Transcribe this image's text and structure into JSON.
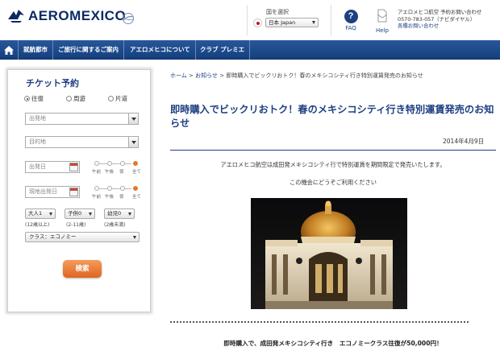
{
  "header": {
    "logo_text": "AEROMEXICO",
    "country_label": "国を選択",
    "country_value": "日本 Japan",
    "faq_label": "FAQ",
    "help_label": "Help",
    "contact_line1": "アエロメヒコ航空 予約お問い合わせ",
    "contact_line2": "0570-783-057（ナビダイヤル）",
    "contact_line3": "各種お問い合わせ"
  },
  "nav": {
    "items": [
      {
        "label": "就航都市"
      },
      {
        "label": "ご旅行に関するご案内"
      },
      {
        "label": "アエロメヒコについて"
      },
      {
        "label": "クラブ プレミエ"
      }
    ]
  },
  "booking": {
    "title": "チケット予約",
    "trip_types": [
      "往復",
      "周遊",
      "片道"
    ],
    "selected_trip": "往復",
    "origin_placeholder": "出発地",
    "destination_placeholder": "目的地",
    "depart_date_placeholder": "出発日",
    "return_date_placeholder": "現地出発日",
    "time_options": [
      "午前",
      "午後",
      "夜",
      "全て"
    ],
    "selected_time": "全て",
    "passengers": [
      {
        "value": "大人1",
        "label": "(12歳以上)"
      },
      {
        "value": "子供0",
        "label": "(2-11歳)"
      },
      {
        "value": "幼児0",
        "label": "(2歳未満)"
      }
    ],
    "cabin_class": "クラス：エコノミー",
    "search_label": "検索"
  },
  "article": {
    "breadcrumb": {
      "home": "ホーム",
      "sep1": " > ",
      "news": "お知らせ",
      "sep2": " > ",
      "current": "即時購入でビックリおトク！春のメキシコシティ行き特別運賃発売のお知らせ"
    },
    "title": "即時購入でビックリおトク！春のメキシコシティ行き特別運賃発売のお知らせ",
    "date": "2014年4月9日",
    "paragraph1": "アエロメヒコ航空は成田発メキシコシティ行で特別運賃を期間限定で発売いたします。",
    "paragraph2": "この機会にどうぞご利用ください",
    "highlight": "即時購入で、成田発メキシコシティ行き　エコノミークラス往復が50,000円！"
  },
  "colors": {
    "brand_navy": "#1d3f83",
    "nav_blue": "#1f4d8f",
    "accent_orange": "#e37a2a"
  }
}
